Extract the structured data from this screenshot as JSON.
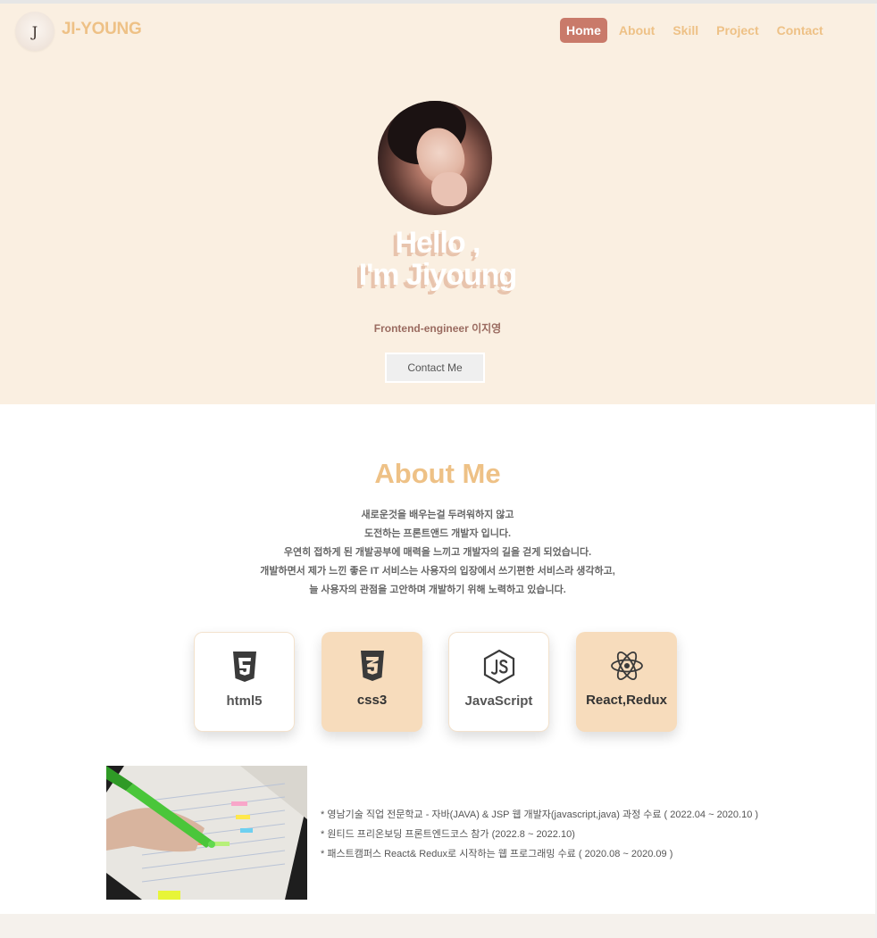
{
  "brand": {
    "logo_letter": "J",
    "name": "JI-YOUNG"
  },
  "nav": {
    "items": [
      {
        "label": "Home",
        "active": true
      },
      {
        "label": "About",
        "active": false
      },
      {
        "label": "Skill",
        "active": false
      },
      {
        "label": "Project",
        "active": false
      },
      {
        "label": "Contact",
        "active": false
      }
    ]
  },
  "hero": {
    "greeting_line1": "Hello ,",
    "greeting_line2": "I'm Jiyoung",
    "subtitle": "Frontend-engineer 이지영",
    "contact_button": "Contact Me"
  },
  "about": {
    "title": "About Me",
    "lines": [
      "새로운것을 배우는걸 두려워하지 않고",
      "도전하는 프론트앤드 개발자 입니다.",
      "우연히 접하게 된 개발공부에 매력을 느끼고 개발자의 길을 걷게 되었습니다.",
      "개발하면서 제가 느낀 좋은 IT 서비스는 사용자의 입장에서 쓰기편한 서비스라 생각하고,",
      "늘 사용자의 관점을 고안하며 개발하기 위해 노력하고 있습니다."
    ]
  },
  "skills": [
    {
      "label": "html5",
      "icon": "html5-icon"
    },
    {
      "label": "css3",
      "icon": "css3-icon"
    },
    {
      "label": "JavaScript",
      "icon": "javascript-icon"
    },
    {
      "label": "React,Redux",
      "icon": "react-icon"
    }
  ],
  "education": [
    "* 영남기술 직업 전문학교 - 자바(JAVA) & JSP 웹 개발자(javascript,java) 과정 수료 ( 2022.04 ~ 2020.10 )",
    "* 원티드 프리온보딩 프론트엔드코스 참가 (2022.8 ~ 2022.10)",
    "* 패스트캠퍼스 React& Redux로 시작하는 웹 프로그래밍 수료 ( 2020.08 ~ 2020.09 )"
  ],
  "colors": {
    "accent": "#eec186",
    "active_nav": "#c97a6a",
    "hero_bg": "#faefe1",
    "card_tan": "#f7dcbc"
  }
}
